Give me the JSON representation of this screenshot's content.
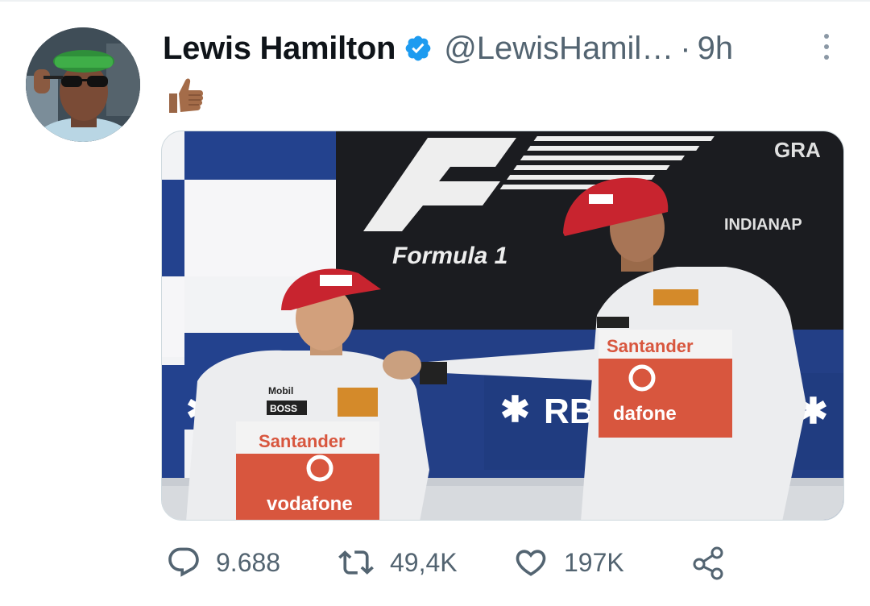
{
  "tweet": {
    "author_name": "Lewis Hamilton",
    "handle": "@LewisHamil…",
    "separator": "·",
    "time": "9h",
    "text_emoji": "👍🏾",
    "media": {
      "banner_text_top": "GRA",
      "banner_text_location": "INDIANAP",
      "logo_text": "Formula 1",
      "sponsor_rb": "RB",
      "sponsor_vodafone_right": "dafone",
      "sponsor_vodafone_left": "vodafone",
      "sponsor_santander_left": "Santander",
      "sponsor_santander_right": "Santander",
      "sponsor_boss": "BOSS",
      "sponsor_mobil": "Mobil"
    },
    "stats": {
      "replies": "9.688",
      "retweets": "49,4K",
      "likes": "197K"
    },
    "colors": {
      "verified": "#1d9bf0",
      "secondary_text": "#536471",
      "primary_text": "#0f1419"
    },
    "icons": {
      "verified": "verified-badge-icon",
      "more": "more-dots-icon",
      "reply": "reply-icon",
      "retweet": "retweet-icon",
      "like": "heart-icon",
      "share": "share-icon"
    }
  }
}
